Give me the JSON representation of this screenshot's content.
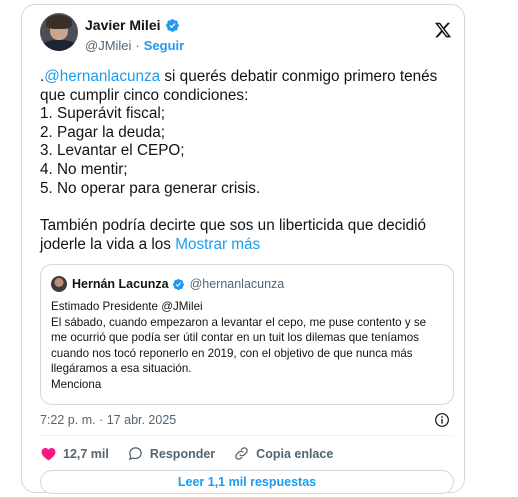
{
  "author": {
    "name": "Javier Milei",
    "handle": "@JMilei",
    "separator": "·",
    "follow_label": "Seguir"
  },
  "post": {
    "mention": "@hernanlacunza",
    "lines": [
      " si querés debatir conmigo primero tenés",
      "que cumplir cinco condiciones:",
      "1. Superávit fiscal;",
      "2. Pagar la deuda;",
      "3. Levantar el CEPO;",
      "4. No mentir;",
      "5. No operar para generar crisis.",
      "También podría decirte que sos un liberticida que decidió",
      "joderle la vida a los "
    ],
    "show_more": "Mostrar más"
  },
  "quote": {
    "name": "Hernán Lacunza",
    "handle": "@hernanlacunza",
    "lines": [
      "Estimado Presidente @JMilei",
      "El sábado, cuando empezaron a levantar el cepo, me puse contento y se",
      "me ocurrió que podía ser útil contar en un tuit los dilemas que teníamos",
      "cuando nos tocó reponerlo en 2019, con el objetivo de que nunca más",
      "llegáramos a esa situación.",
      "Menciona"
    ]
  },
  "meta": {
    "time": "7:22 p. m.",
    "separator": "·",
    "date": "17 abr. 2025"
  },
  "actions": {
    "likes": "12,7 mil",
    "reply_label": "Responder",
    "copy_link_label": "Copia enlace"
  },
  "replies_button": "Leer 1,1 mil respuestas",
  "colors": {
    "accent": "#1d9bf0",
    "like": "#f91880",
    "text": "#0f1419",
    "muted": "#536471",
    "border": "#cfd9de"
  },
  "icons": [
    "verified-badge-icon",
    "x-logo-icon",
    "info-icon",
    "heart-icon",
    "reply-icon",
    "link-icon"
  ]
}
